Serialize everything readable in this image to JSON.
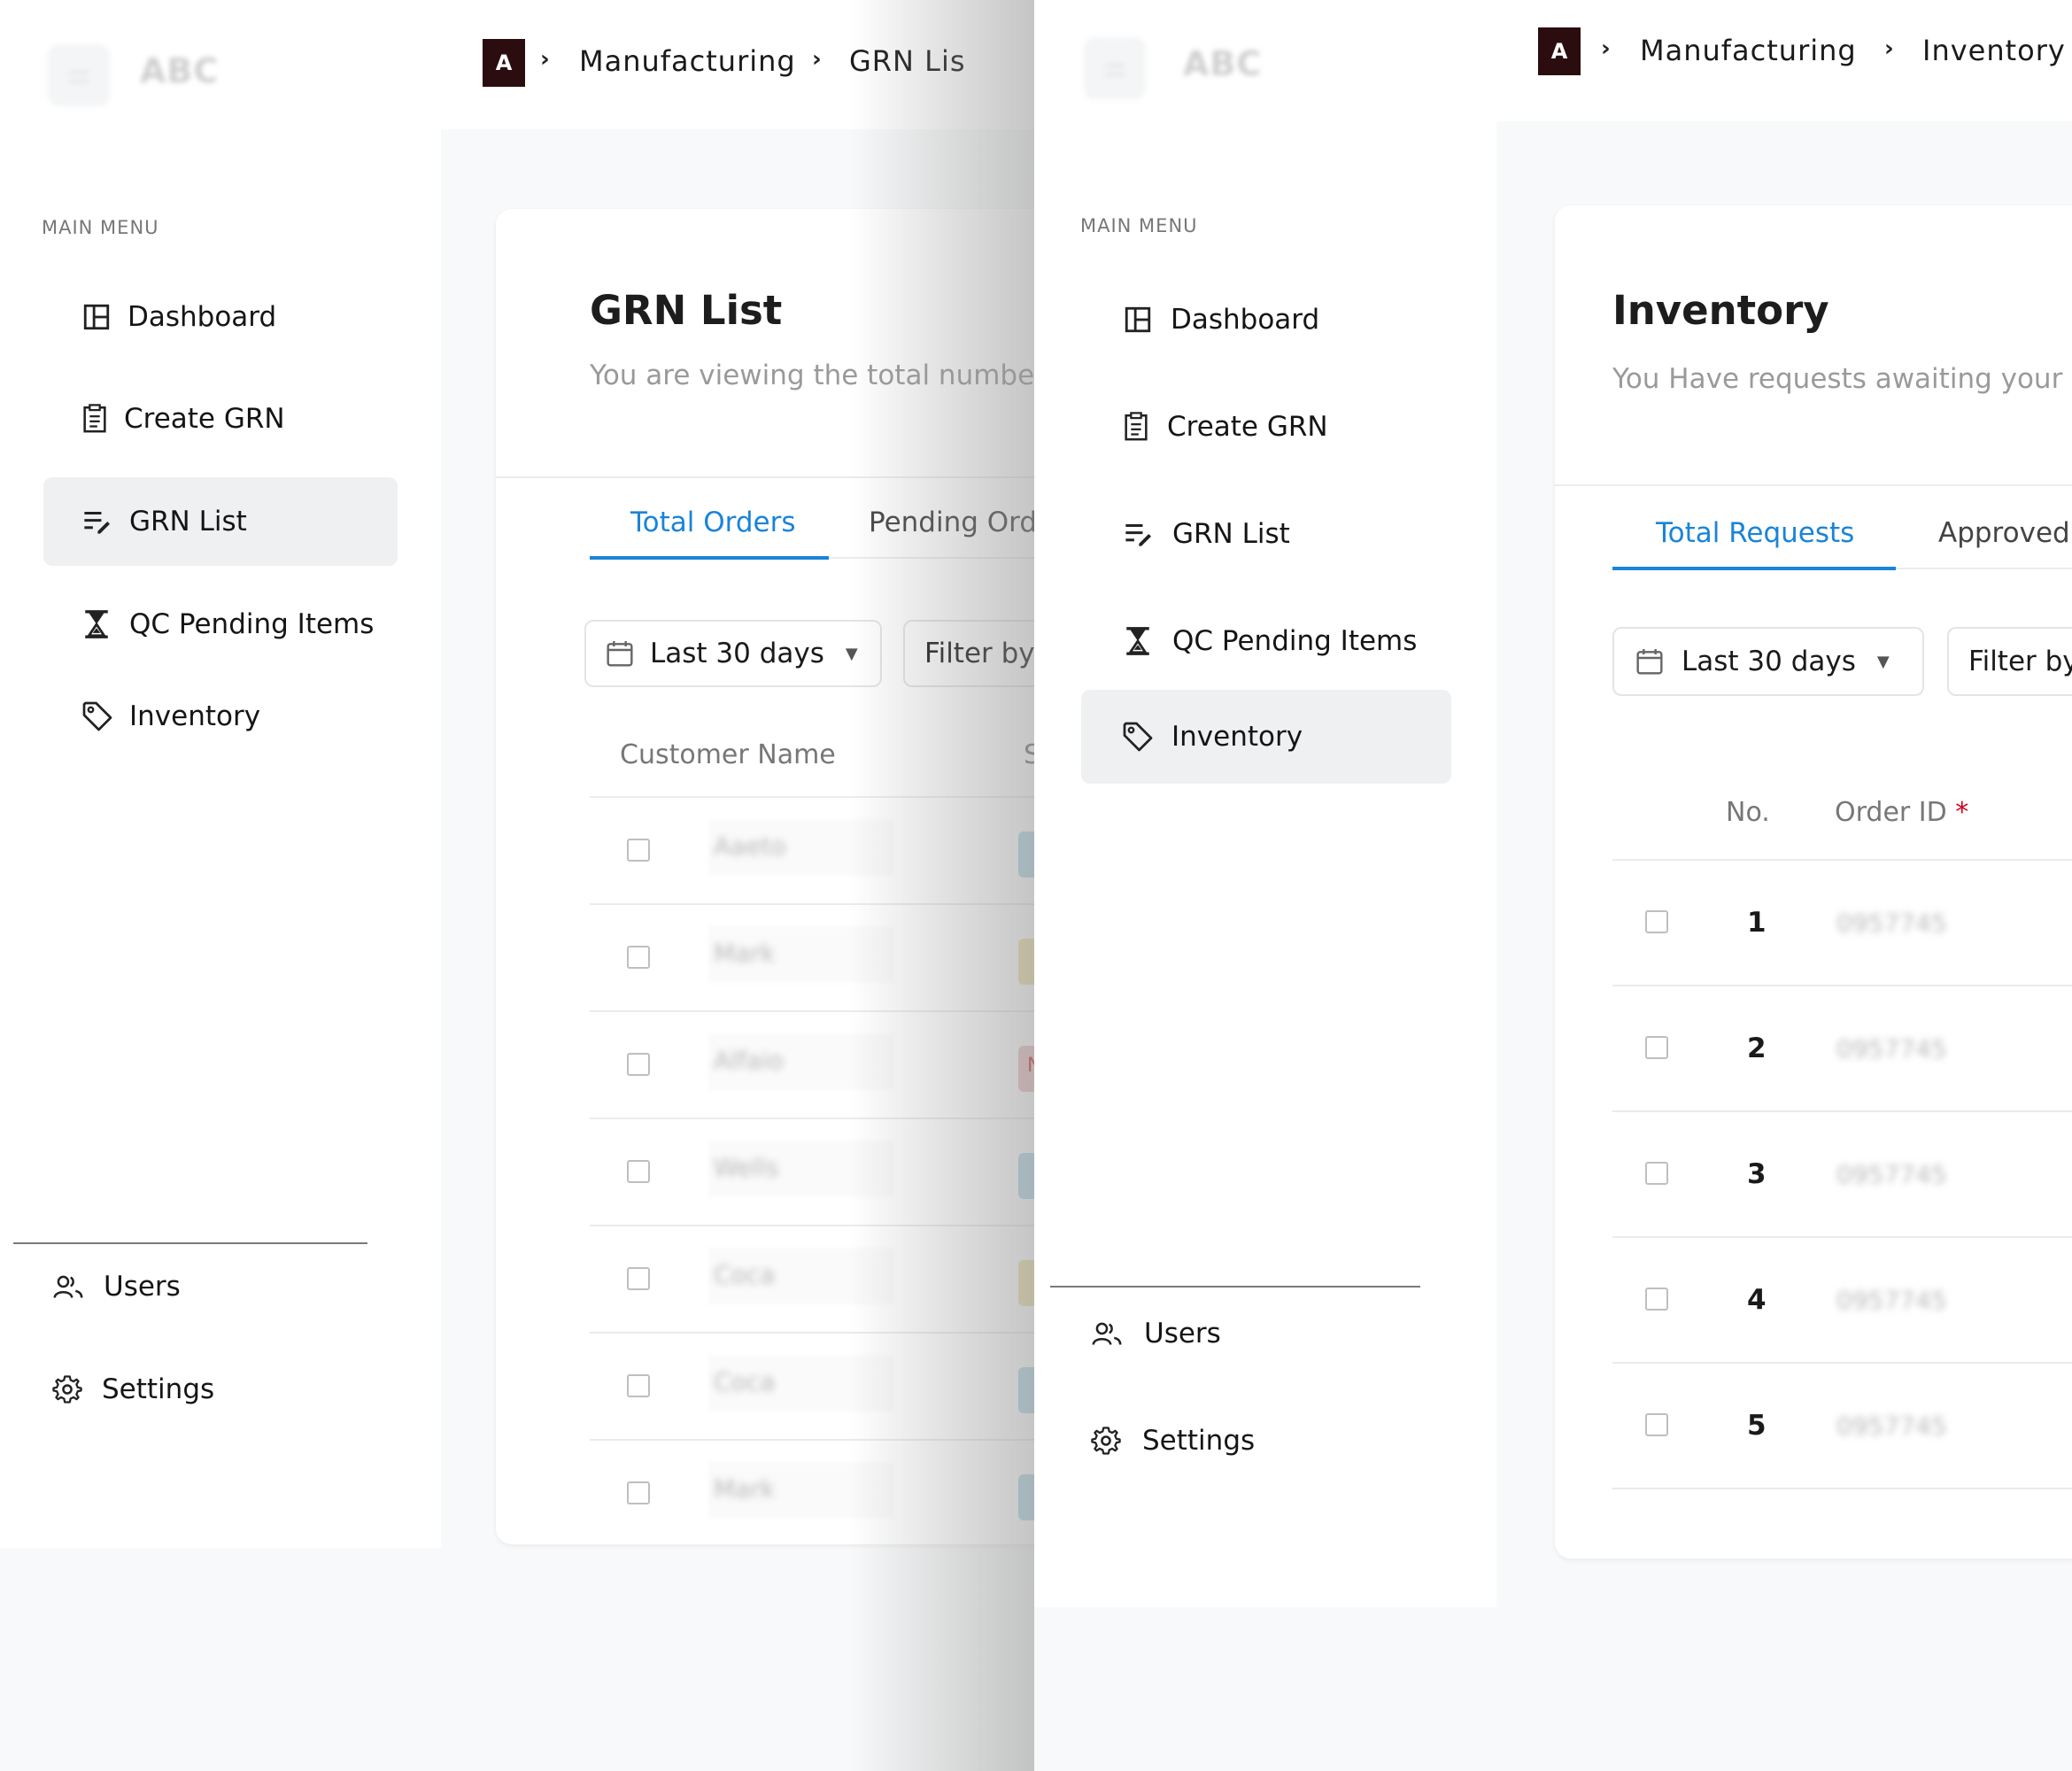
{
  "brand": {
    "logo_text": "ABC",
    "crumb_initial": "A"
  },
  "left": {
    "sidebar": {
      "menu_title": "MAIN MENU",
      "items": [
        {
          "label": "Dashboard"
        },
        {
          "label": "Create GRN"
        },
        {
          "label": "GRN List"
        },
        {
          "label": "QC Pending Items"
        },
        {
          "label": "Inventory"
        }
      ],
      "bottom": [
        {
          "label": "Users"
        },
        {
          "label": "Settings"
        }
      ],
      "active": "GRN List"
    },
    "breadcrumb": [
      "Manufacturing",
      "GRN Lis"
    ],
    "title": "GRN List",
    "subtitle": "You are viewing the total number",
    "tabs": [
      {
        "label": "Total Orders",
        "active": true
      },
      {
        "label": "Pending Orde",
        "active": false
      }
    ],
    "date_filter": "Last 30 days",
    "filter_button": "Filter by",
    "columns": [
      "Customer Name",
      "S"
    ],
    "rows": [
      {
        "name": "Aaeto",
        "status_color": "#b7dbe6"
      },
      {
        "name": "Mark",
        "status_color": "#ece3b0"
      },
      {
        "name": "Alfaio",
        "status_color": "#ecc6c6",
        "status_letter": "N"
      },
      {
        "name": "Wells",
        "status_color": "#b7dbe6"
      },
      {
        "name": "Coca",
        "status_color": "#ece3b0"
      },
      {
        "name": "Coca",
        "status_color": "#b7dbe6"
      },
      {
        "name": "Mark",
        "status_color": "#b7dbe6"
      }
    ]
  },
  "right": {
    "sidebar": {
      "menu_title": "MAIN MENU",
      "items": [
        {
          "label": "Dashboard"
        },
        {
          "label": "Create GRN"
        },
        {
          "label": "GRN List"
        },
        {
          "label": "QC Pending Items"
        },
        {
          "label": "Inventory"
        }
      ],
      "bottom": [
        {
          "label": "Users"
        },
        {
          "label": "Settings"
        }
      ],
      "active": "Inventory"
    },
    "breadcrumb": [
      "Manufacturing",
      "Inventory"
    ],
    "title": "Inventory",
    "subtitle": "You Have requests awaiting your",
    "tabs": [
      {
        "label": "Total Requests",
        "active": true
      },
      {
        "label": "Approved",
        "active": false
      }
    ],
    "date_filter": "Last 30 days",
    "filter_button": "Filter by",
    "columns": {
      "no": "No.",
      "order_id": "Order ID",
      "required_mark": "*"
    },
    "rows": [
      {
        "no": "1",
        "order_id": "0957745"
      },
      {
        "no": "2",
        "order_id": "0957745"
      },
      {
        "no": "3",
        "order_id": "0957745"
      },
      {
        "no": "4",
        "order_id": "0957745"
      },
      {
        "no": "5",
        "order_id": "0957745"
      }
    ]
  },
  "colors": {
    "accent": "#1a84d8",
    "crumb_box": "#2b0d10",
    "active_item_bg": "#eef0f2",
    "required": "#d0021b"
  }
}
